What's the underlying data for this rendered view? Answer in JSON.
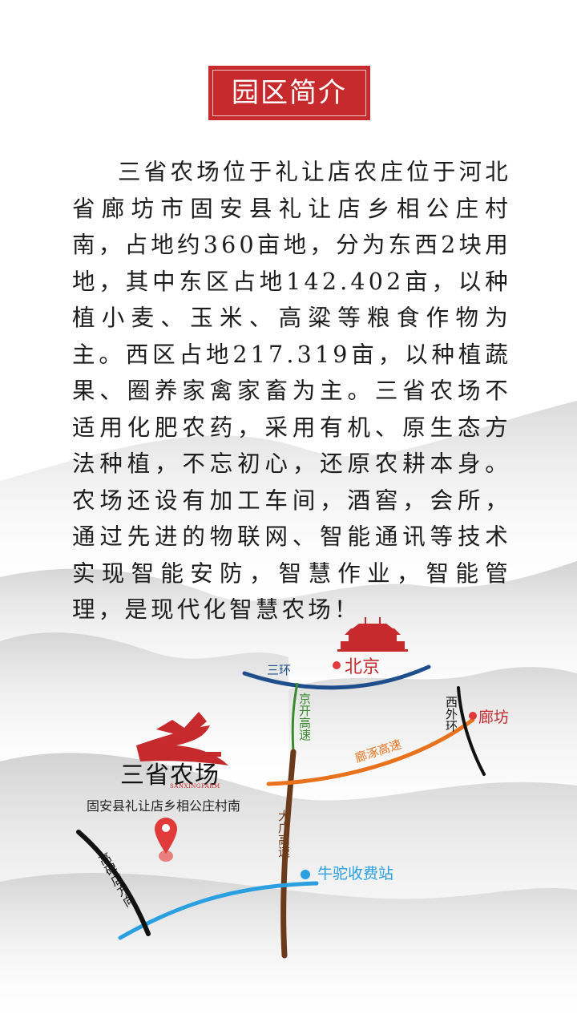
{
  "title": "园区简介",
  "intro": "三省农场位于礼让店农庄位于河北省廊坊市固安县礼让店乡相公庄村南，占地约360亩地，分为东西2块用地，其中东区占地142.402亩，以种植小麦、玉米、高粱等粮食作物为主。西区占地217.319亩，以种植蔬果、圈养家禽家畜为主。三省农场不适用化肥农药，采用有机、原生态方法种植，不忘初心，还原农耕本身。农场还设有加工车间，酒窖，会所，通过先进的物联网、智能通讯等技术实现智能安防，智慧作业，智能管理，是现代化智慧农场！",
  "map": {
    "beijing": "北京",
    "ring3": "三环",
    "jingkai": "京开高速",
    "daguang": "大广高速",
    "xiwaihuan": "西外环",
    "langfang": "廊坊",
    "langzhuo": "廊涿高速",
    "niutuo": "牛驼收费站",
    "gaobeidian": "高碑店方向",
    "farm_name": "三省农场",
    "farm_en": "SANXINGFARM",
    "farm_address": "固安县礼让店乡相公庄村南"
  },
  "colors": {
    "title_red": "#c62a2d",
    "ring3_blue": "#1f4e8c",
    "jingkai_green": "#3a8a2e",
    "daguang_brown": "#6b3a1a",
    "langzhuo_orange": "#e8731c",
    "niutuo_blue": "#2aa0e0",
    "marker_red": "#e03a3a"
  }
}
